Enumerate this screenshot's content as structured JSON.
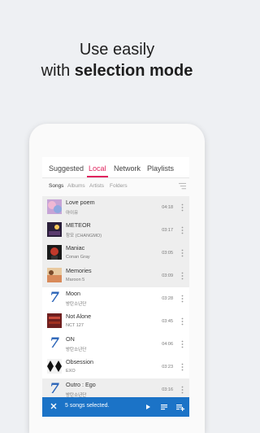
{
  "headline": {
    "line1": "Use easily",
    "line2_prefix": "with ",
    "line2_bold": "selection mode"
  },
  "tabs": [
    {
      "label": "Suggested",
      "active": false
    },
    {
      "label": "Local",
      "active": true
    },
    {
      "label": "Network",
      "active": false
    },
    {
      "label": "Playlists",
      "active": false
    }
  ],
  "subtabs": [
    {
      "label": "Songs",
      "active": true
    },
    {
      "label": "Albums",
      "active": false
    },
    {
      "label": "Artists",
      "active": false
    },
    {
      "label": "Folders",
      "active": false
    }
  ],
  "songs": [
    {
      "title": "Love poem",
      "artist": "아이유",
      "duration": "04:18",
      "selected": true
    },
    {
      "title": "METEOR",
      "artist": "창모 (CHANGMO)",
      "duration": "03:17",
      "selected": true
    },
    {
      "title": "Maniac",
      "artist": "Conan Gray",
      "duration": "03:05",
      "selected": true
    },
    {
      "title": "Memories",
      "artist": "Maroon 5",
      "duration": "03:09",
      "selected": true
    },
    {
      "title": "Moon",
      "artist": "방탄소년단",
      "duration": "03:28",
      "selected": false
    },
    {
      "title": "Not Alone",
      "artist": "NCT 127",
      "duration": "03:45",
      "selected": false
    },
    {
      "title": "ON",
      "artist": "방탄소년단",
      "duration": "04:06",
      "selected": false
    },
    {
      "title": "Obsession",
      "artist": "EXO",
      "duration": "03:23",
      "selected": false
    },
    {
      "title": "Outro : Ego",
      "artist": "방탄소년단",
      "duration": "03:16",
      "selected": true
    }
  ],
  "selection_bar": {
    "text": "5 songs selected."
  },
  "colors": {
    "accent": "#e0245e",
    "bar": "#1b73c7"
  }
}
